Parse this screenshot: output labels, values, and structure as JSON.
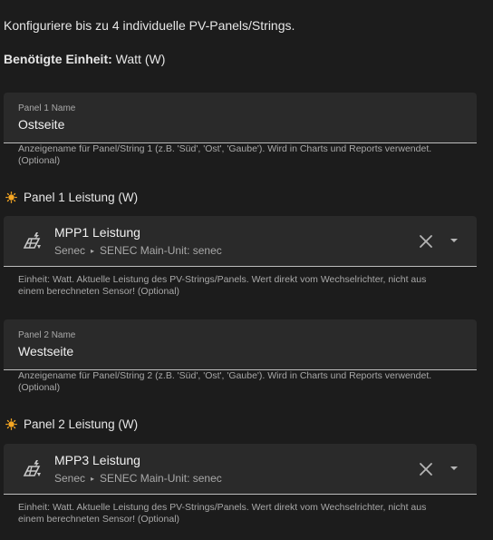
{
  "intro": "Konfiguriere bis zu 4 individuelle PV-Panels/Strings.",
  "unit_label": "Benötigte Einheit:",
  "unit_value": "Watt (W)",
  "panels": [
    {
      "name_label": "Panel 1 Name",
      "name_value": "Ostseite",
      "name_helper_line1": "Anzeigename für Panel/String 1 (z.B. 'Süd', 'Ost', 'Gaube'). Wird in Charts und Reports verwendet.",
      "name_helper_line2": "(Optional)",
      "power_title": "Panel 1 Leistung (W)",
      "entity_name": "MPP1 Leistung",
      "entity_device": "Senec",
      "entity_area": "SENEC Main-Unit: senec",
      "power_helper_line1": "Einheit: Watt. Aktuelle Leistung des PV-Strings/Panels. Wert direkt vom Wechselrichter, nicht aus",
      "power_helper_line2": "einem berechneten Sensor! (Optional)"
    },
    {
      "name_label": "Panel 2 Name",
      "name_value": "Westseite",
      "name_helper_line1": "Anzeigename für Panel/String 2 (z.B. 'Süd', 'Ost', 'Gaube'). Wird in Charts und Reports verwendet.",
      "name_helper_line2": "(Optional)",
      "power_title": "Panel 2 Leistung (W)",
      "entity_name": "MPP3 Leistung",
      "entity_device": "Senec",
      "entity_area": "SENEC Main-Unit: senec",
      "power_helper_line1": "Einheit: Watt. Aktuelle Leistung des PV-Strings/Panels. Wert direkt vom Wechselrichter, nicht aus",
      "power_helper_line2": "einem berechneten Sensor! (Optional)"
    }
  ],
  "separator_glyph": "▸",
  "icons": {
    "section": "sun-icon",
    "entity": "solar-power-icon",
    "clear": "close-icon",
    "dropdown": "caret-down-icon"
  },
  "colors": {
    "background": "#1c1c1c",
    "field": "#2a2a2a",
    "sun": "#f5a623"
  }
}
